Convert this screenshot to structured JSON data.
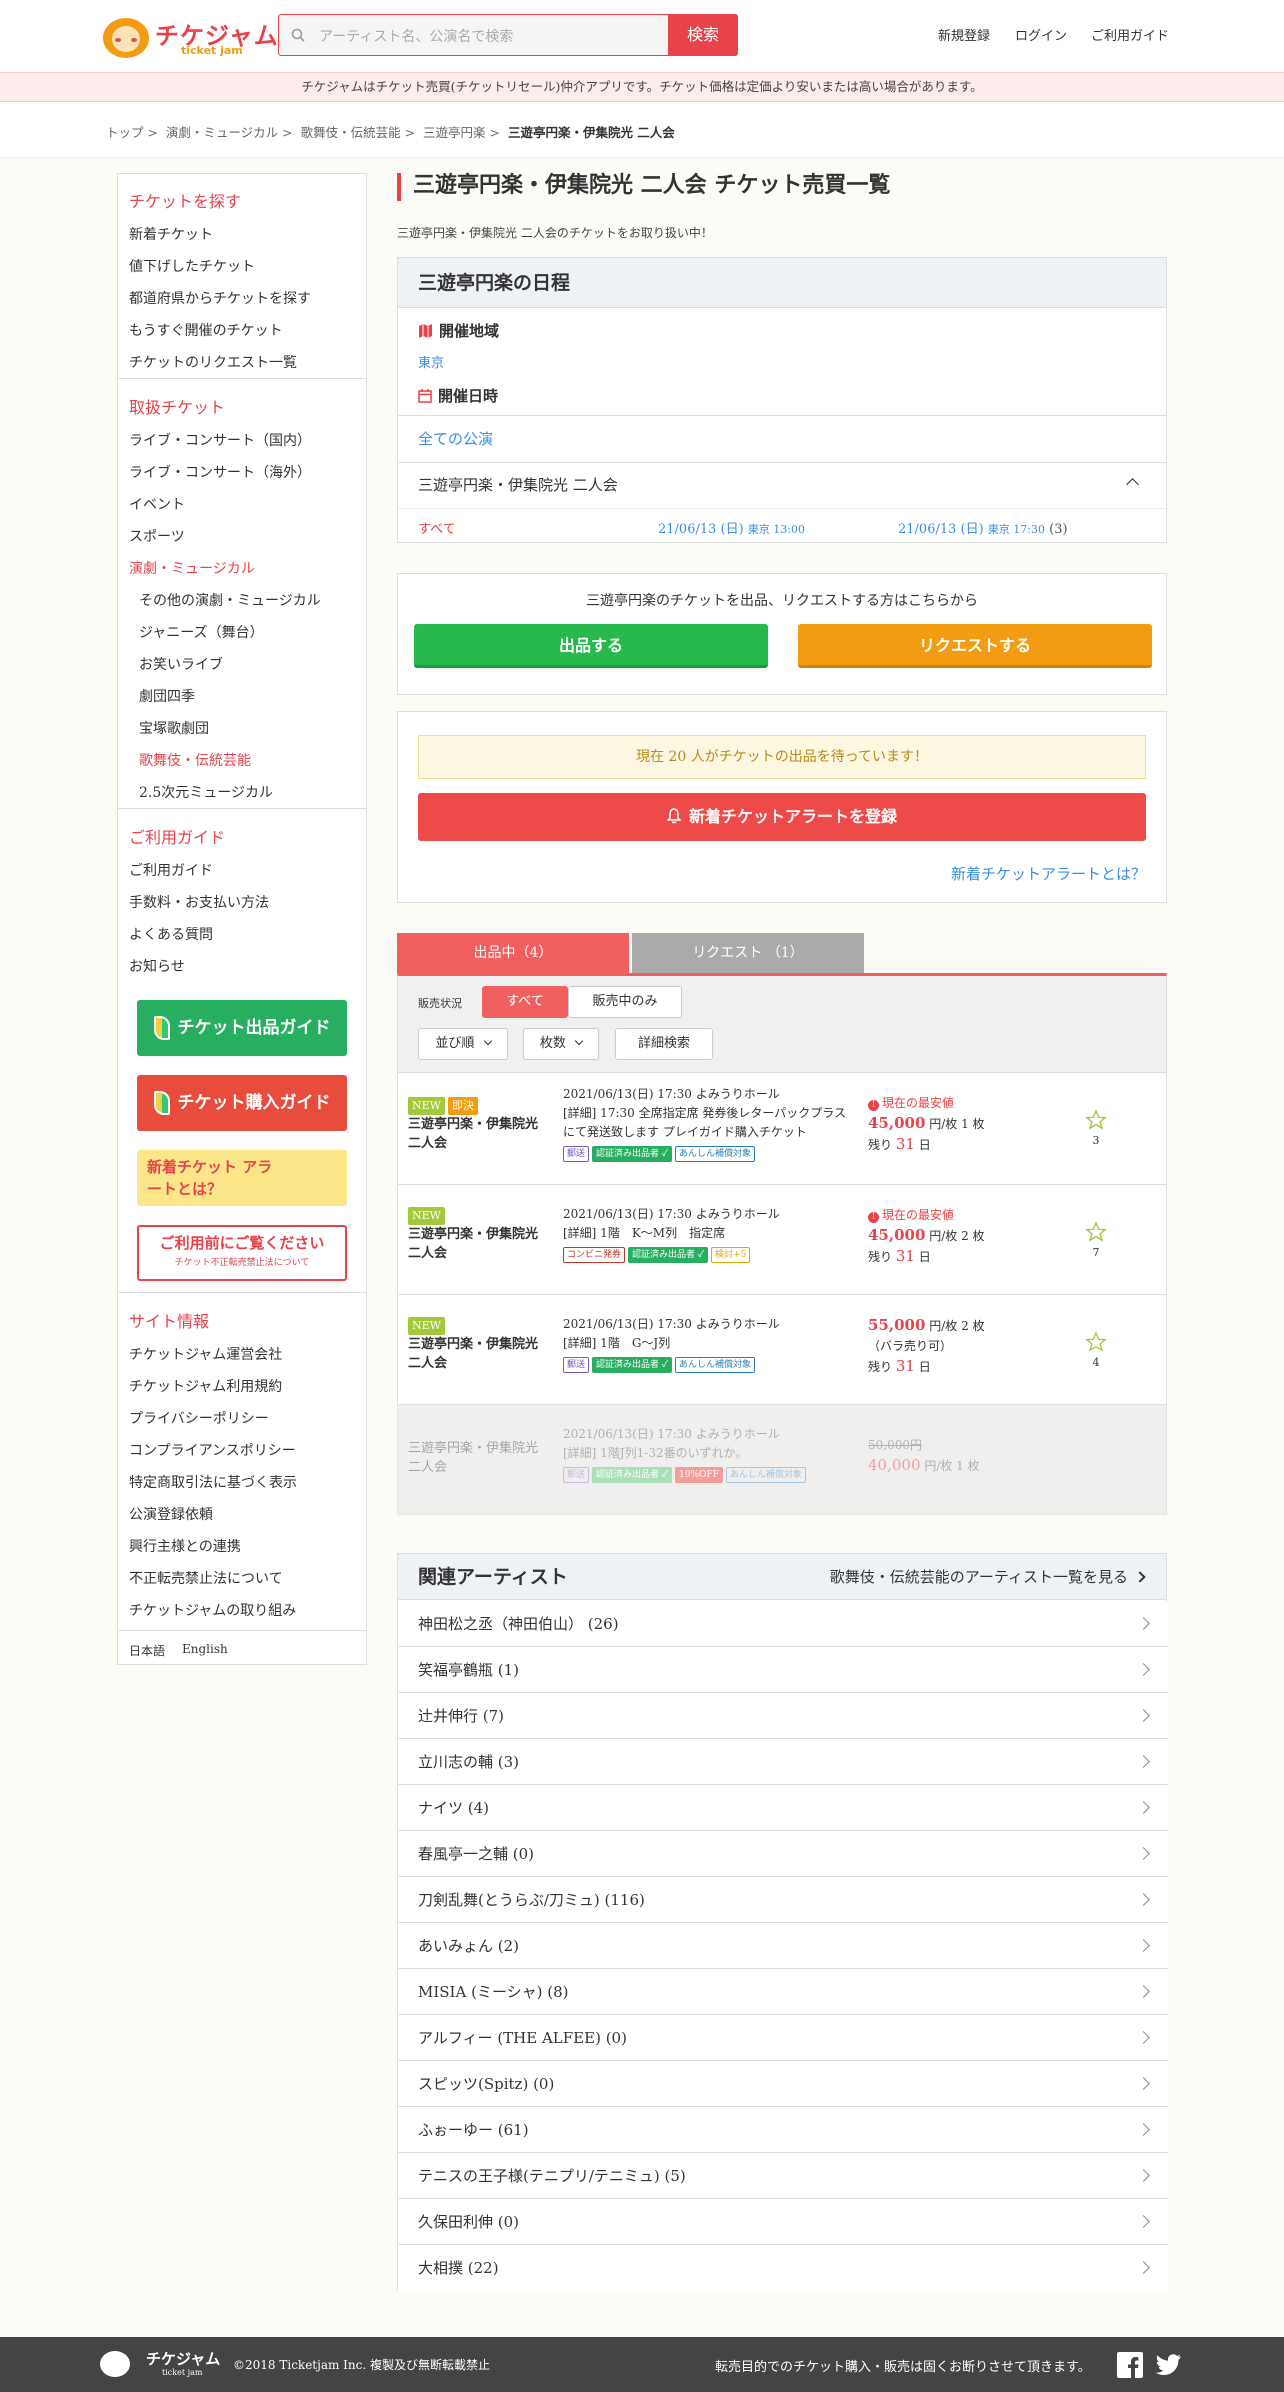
{
  "header": {
    "logo_text": "チケジャム",
    "logo_sub": "ticket jam",
    "search_placeholder": "アーティスト名、公演名で検索",
    "search_button": "検索",
    "nav": [
      "新規登録",
      "ログイン",
      "ご利用ガイド"
    ]
  },
  "notice": "チケジャムはチケット売買(チケットリセール)仲介アプリです。チケット価格は定価より安いまたは高い場合があります。",
  "breadcrumb": [
    "トップ",
    "演劇・ミュージカル",
    "歌舞伎・伝統芸能",
    "三遊亭円楽",
    "三遊亭円楽・伊集院光 二人会"
  ],
  "sidebar": {
    "find_title": "チケットを探す",
    "find_items": [
      "新着チケット",
      "値下げしたチケット",
      "都道府県からチケットを探す",
      "もうすぐ開催のチケット",
      "チケットのリクエスト一覧"
    ],
    "handle_title": "取扱チケット",
    "handle_items": [
      "ライブ・コンサート（国内）",
      "ライブ・コンサート（海外）",
      "イベント",
      "スポーツ",
      "演劇・ミュージカル"
    ],
    "handle_sub": [
      "その他の演劇・ミュージカル",
      "ジャニーズ（舞台）",
      "お笑いライブ",
      "劇団四季",
      "宝塚歌劇団",
      "歌舞伎・伝統芸能",
      "2.5次元ミュージカル"
    ],
    "guide_title": "ご利用ガイド",
    "guide_items": [
      "ご利用ガイド",
      "手数料・お支払い方法",
      "よくある質問",
      "お知らせ"
    ],
    "banners": [
      "チケット出品ガイド",
      "チケット購入ガイド",
      "新着チケット アラートとは？",
      "ご利用前にご覧ください",
      "チケット不正転売禁止法について"
    ],
    "site_title": "サイト情報",
    "site_items": [
      "チケットジャム運営会社",
      "チケットジャム利用規約",
      "プライバシーポリシー",
      "コンプライアンスポリシー",
      "特定商取引法に基づく表示",
      "公演登録依頼",
      "興行主様との連携",
      "不正転売禁止法について",
      "チケットジャムの取り組み"
    ],
    "languages": [
      "日本語",
      "English"
    ]
  },
  "main": {
    "title": "三遊亭円楽・伊集院光 二人会 チケット売買一覧",
    "desc": "三遊亭円楽・伊集院光 二人会のチケットをお取り扱い中！",
    "schedule": {
      "heading": "三遊亭円楽の日程",
      "region_label": "開催地域",
      "region_value": "東京",
      "date_label": "開催日時",
      "all_link": "全ての公演",
      "event_name": "三遊亭円楽・伊集院光 二人会",
      "dates": [
        "すべて",
        "21/06/13 (日)",
        "東京 13:00",
        "21/06/13 (日)",
        "東京 17:30",
        "(3)"
      ]
    },
    "cta": {
      "text": "三遊亭円楽のチケットを出品、リクエストする方はこちらから",
      "sell": "出品する",
      "request": "リクエストする"
    },
    "alert": {
      "waiting": "現在 20 人がチケットの出品を待っています！",
      "register": "新着チケットアラートを登録",
      "what": "新着チケットアラートとは？"
    },
    "tabs": [
      "出品中（4）",
      "リクエスト （1）"
    ],
    "filter": {
      "label": "販売状況",
      "all": "すべて",
      "onsale": "販売中のみ",
      "sort": "並び順",
      "count": "枚数",
      "detail": "詳細検索"
    },
    "listings": [
      {
        "tags": [
          "NEW",
          "即決"
        ],
        "name": "三遊亭円楽・伊集院光 二人会",
        "line1": "2021/06/13(日) 17:30 よみうりホール",
        "line2": "[詳細] 17:30 全席指定席 発券後レターパックプラスにて発送致します プレイガイド購入チケット",
        "badges": [
          "郵送",
          "認証済み出品者 ✓",
          "あんしん補償対象"
        ],
        "lowest": "現在の最安値",
        "price": "45,000",
        "unit": "円/枚 1 枚",
        "remain_pre": "残り",
        "remain": "31",
        "remain_post": "日",
        "fav": "3"
      },
      {
        "tags": [
          "NEW"
        ],
        "name": "三遊亭円楽・伊集院光 二人会",
        "line1": "2021/06/13(日) 17:30 よみうりホール",
        "line2": "[詳細] 1階　K〜M列　指定席",
        "badges": [
          "コンビニ発券",
          "認証済み出品者 ✓",
          "検討+5"
        ],
        "lowest": "現在の最安値",
        "price": "45,000",
        "unit": "円/枚 2 枚",
        "remain_pre": "残り",
        "remain": "31",
        "remain_post": "日",
        "fav": "7"
      },
      {
        "tags": [
          "NEW"
        ],
        "name": "三遊亭円楽・伊集院光 二人会",
        "line1": "2021/06/13(日) 17:30 よみうりホール",
        "line2": "[詳細] 1階　G〜J列",
        "badges": [
          "郵送",
          "認証済み出品者 ✓",
          "あんしん補償対象"
        ],
        "price": "55,000",
        "unit": "円/枚 2 枚",
        "note": "（バラ売り可）",
        "remain_pre": "残り",
        "remain": "31",
        "remain_post": "日",
        "fav": "4"
      },
      {
        "tags": [],
        "name": "三遊亭円楽・伊集院光 二人会",
        "line1": "2021/06/13(日) 17:30 よみうりホール",
        "line2": "[詳細] 1階J列1-32番のいずれか。",
        "badges": [
          "郵送",
          "認証済み出品者 ✓",
          "19%OFF",
          "あんしん補償対象"
        ],
        "old_price": "50,000円",
        "price": "40,000",
        "unit": "円/枚 1 枚"
      }
    ],
    "related": {
      "heading": "関連アーティスト",
      "link": "歌舞伎・伝統芸能のアーティスト一覧を見る",
      "artists": [
        "神田松之丞（神田伯山） (26)",
        "笑福亭鶴瓶 (1)",
        "辻井伸行 (7)",
        "立川志の輔 (3)",
        "ナイツ (4)",
        "春風亭一之輔 (0)",
        "刀剣乱舞(とうらぶ/刀ミュ) (116)",
        "あいみょん (2)",
        "MISIA (ミーシャ) (8)",
        "アルフィー (THE ALFEE) (0)",
        "スピッツ(Spitz) (0)",
        "ふぉーゆー (61)",
        "テニスの王子様(テニプリ/テニミュ) (5)",
        "久保田利伸 (0)",
        "大相撲 (22)"
      ]
    }
  },
  "footer": {
    "logo": "チケジャム",
    "logo_sub": "ticket jam",
    "copyright": "©2018 Ticketjam Inc. 複製及び無断転載禁止",
    "notice": "転売目的でのチケット購入・販売は固くお断りさせて頂きます。"
  }
}
